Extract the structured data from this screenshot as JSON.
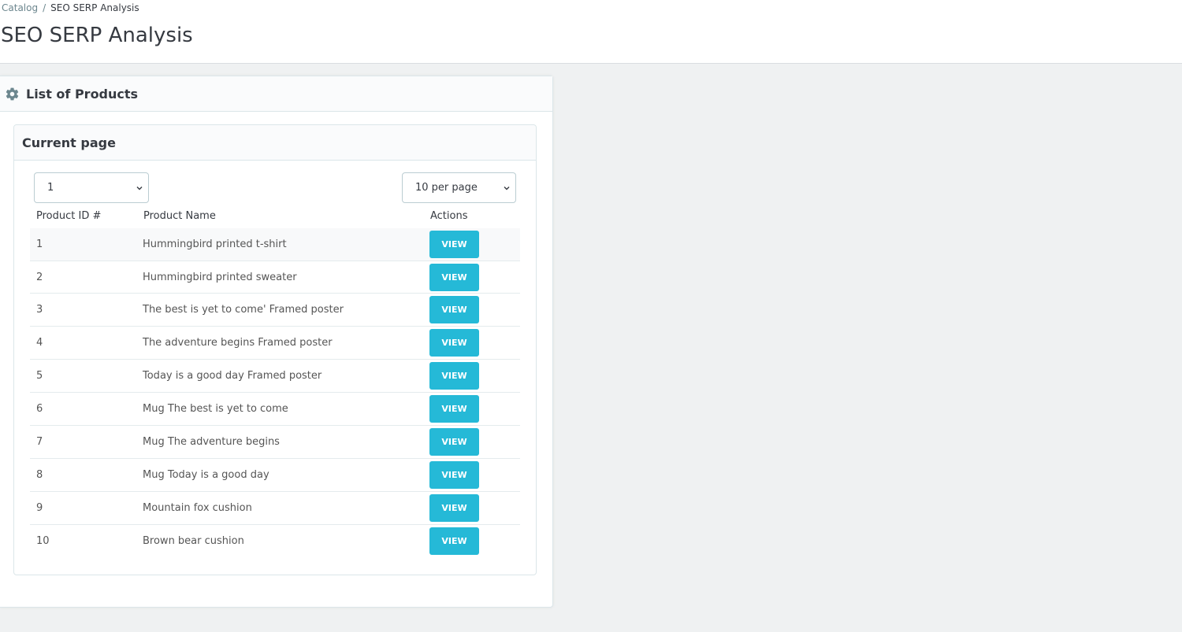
{
  "breadcrumb": {
    "parent": "Catalog",
    "separator": "/",
    "current": "SEO SERP Analysis"
  },
  "page_title": "SEO SERP Analysis",
  "panel": {
    "title": "List of Products",
    "icon": "gear-icon"
  },
  "card": {
    "title": "Current page",
    "page_select": {
      "value": "1"
    },
    "per_page_select": {
      "value": "10 per page"
    },
    "columns": {
      "id": "Product ID #",
      "name": "Product Name",
      "actions": "Actions"
    },
    "rows": [
      {
        "id": "1",
        "name": "Hummingbird printed t-shirt",
        "action": "VIEW"
      },
      {
        "id": "2",
        "name": "Hummingbird printed sweater",
        "action": "VIEW"
      },
      {
        "id": "3",
        "name": "The best is yet to come' Framed poster",
        "action": "VIEW"
      },
      {
        "id": "4",
        "name": "The adventure begins Framed poster",
        "action": "VIEW"
      },
      {
        "id": "5",
        "name": "Today is a good day Framed poster",
        "action": "VIEW"
      },
      {
        "id": "6",
        "name": "Mug The best is yet to come",
        "action": "VIEW"
      },
      {
        "id": "7",
        "name": "Mug The adventure begins",
        "action": "VIEW"
      },
      {
        "id": "8",
        "name": "Mug Today is a good day",
        "action": "VIEW"
      },
      {
        "id": "9",
        "name": "Mountain fox cushion",
        "action": "VIEW"
      },
      {
        "id": "10",
        "name": "Brown bear cushion",
        "action": "VIEW"
      }
    ]
  },
  "colors": {
    "accent": "#25b9d7",
    "text": "#363a41",
    "background": "#eff1f2"
  }
}
